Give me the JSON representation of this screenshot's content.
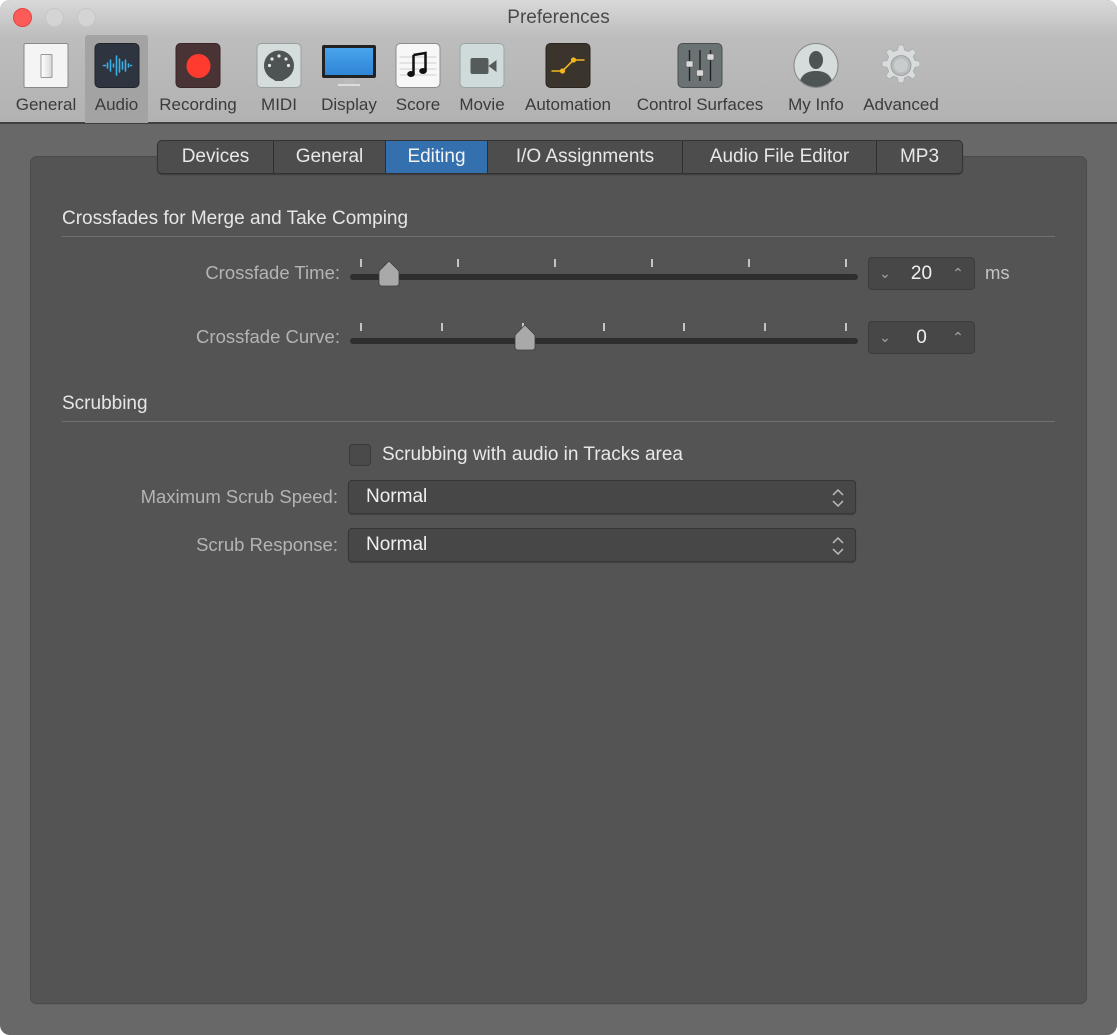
{
  "window": {
    "title": "Preferences"
  },
  "toolbar": {
    "items": [
      {
        "label": "General",
        "icon": "general-switch-icon"
      },
      {
        "label": "Audio",
        "icon": "audio-waveform-icon",
        "active": true
      },
      {
        "label": "Recording",
        "icon": "record-icon"
      },
      {
        "label": "MIDI",
        "icon": "midi-connector-icon"
      },
      {
        "label": "Display",
        "icon": "display-monitor-icon"
      },
      {
        "label": "Score",
        "icon": "score-note-icon"
      },
      {
        "label": "Movie",
        "icon": "movie-camera-icon"
      },
      {
        "label": "Automation",
        "icon": "automation-icon"
      },
      {
        "label": "Control Surfaces",
        "icon": "faders-icon"
      },
      {
        "label": "My Info",
        "icon": "user-silhouette-icon"
      },
      {
        "label": "Advanced",
        "icon": "gear-icon"
      }
    ]
  },
  "tabs": [
    {
      "label": "Devices"
    },
    {
      "label": "General"
    },
    {
      "label": "Editing",
      "active": true
    },
    {
      "label": "I/O Assignments"
    },
    {
      "label": "Audio File Editor"
    },
    {
      "label": "MP3"
    }
  ],
  "crossfades": {
    "section_title": "Crossfades for Merge and Take Comping",
    "time": {
      "label": "Crossfade Time:",
      "value": "20",
      "unit": "ms",
      "slider_fraction": 0.06,
      "tick_count": 6
    },
    "curve": {
      "label": "Crossfade Curve:",
      "value": "0",
      "slider_fraction": 0.34,
      "tick_count": 7
    }
  },
  "scrubbing": {
    "section_title": "Scrubbing",
    "checkbox": {
      "label": "Scrubbing with audio in Tracks area",
      "checked": false
    },
    "max_speed": {
      "label": "Maximum Scrub Speed:",
      "value": "Normal"
    },
    "response": {
      "label": "Scrub Response:",
      "value": "Normal"
    }
  },
  "colors": {
    "accent": "#3570ae",
    "close_button": "#fc5b57",
    "record_red": "#ff3b30",
    "audio_blue": "#3ab0e6",
    "automation_yellow": "#f2b61f"
  }
}
